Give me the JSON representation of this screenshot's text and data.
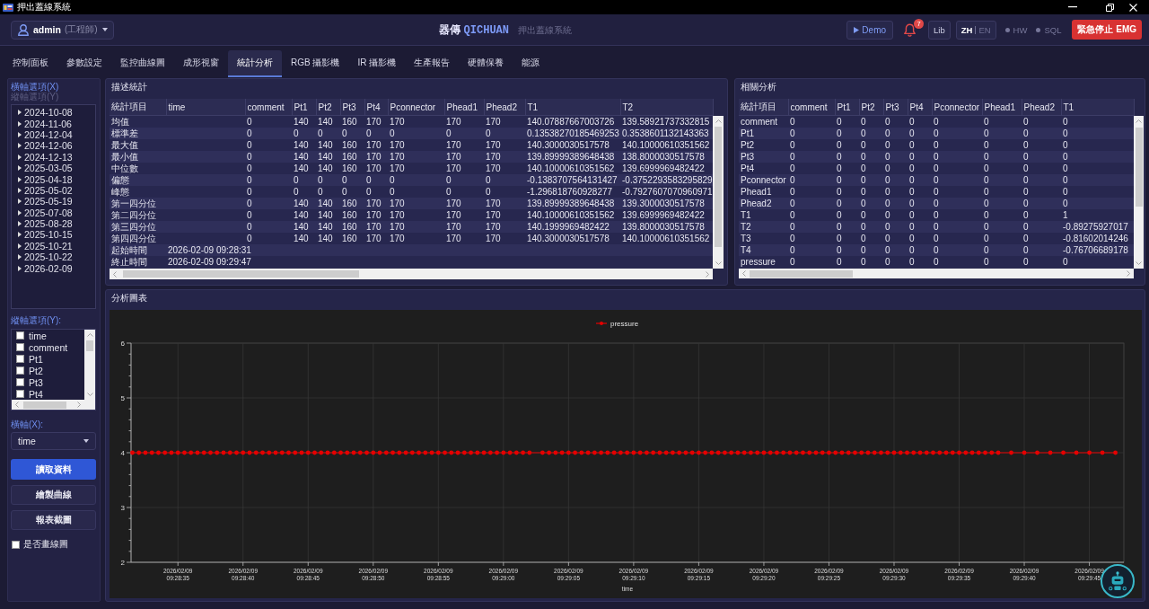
{
  "window": {
    "title": "押出蓋線系統"
  },
  "header": {
    "user": {
      "name": "admin",
      "role": "(工程師)"
    },
    "brand": {
      "chinese_name": "器傳",
      "english_name": "QICHUAN",
      "subtitle": "押出蓋線系統"
    },
    "demo_button": {
      "label": "Demo"
    },
    "notifications": {
      "count": "7"
    },
    "lib_button": {
      "label": "Lib"
    },
    "languages": [
      {
        "label": "ZH",
        "selected": true
      },
      {
        "label": "EN",
        "selected": false
      }
    ],
    "status": [
      {
        "label": "HW",
        "on": false
      },
      {
        "label": "SQL",
        "on": false
      }
    ],
    "emergency_button": {
      "label": "緊急停止 EMG"
    }
  },
  "tabs": [
    {
      "label": "控制面板",
      "selected": false
    },
    {
      "label": "參數設定",
      "selected": false
    },
    {
      "label": "監控曲線圖",
      "selected": false
    },
    {
      "label": "成形視窗",
      "selected": false
    },
    {
      "label": "統計分析",
      "selected": true
    },
    {
      "label": "RGB 攝影機",
      "selected": false
    },
    {
      "label": "IR 攝影機",
      "selected": false
    },
    {
      "label": "生產報告",
      "selected": false
    },
    {
      "label": "硬體保養",
      "selected": false
    },
    {
      "label": "能源",
      "selected": false
    }
  ],
  "sidebar": {
    "axis_tabs": [
      {
        "label": "橫軸選項(X)",
        "selected": true
      },
      {
        "label": "縱軸選項(Y)",
        "selected": false
      }
    ],
    "dates": [
      {
        "label": "2024-10-08",
        "expanded": false
      },
      {
        "label": "2024-11-06",
        "expanded": false
      },
      {
        "label": "2024-12-04",
        "expanded": false
      },
      {
        "label": "2024-12-06",
        "expanded": false
      },
      {
        "label": "2024-12-13",
        "expanded": false
      },
      {
        "label": "2025-03-05",
        "expanded": false
      },
      {
        "label": "2025-04-18",
        "expanded": false
      },
      {
        "label": "2025-05-02",
        "expanded": false
      },
      {
        "label": "2025-05-19",
        "expanded": false
      },
      {
        "label": "2025-07-08",
        "expanded": false
      },
      {
        "label": "2025-08-28",
        "expanded": false
      },
      {
        "label": "2025-10-15",
        "expanded": false
      },
      {
        "label": "2025-10-21",
        "expanded": false
      },
      {
        "label": "2025-10-22",
        "expanded": false
      },
      {
        "label": "2026-02-09",
        "expanded": false
      }
    ],
    "y_axis_label": "縱軸選項(Y):",
    "y_options": [
      {
        "label": "time",
        "checked": false
      },
      {
        "label": "comment",
        "checked": false
      },
      {
        "label": "Pt1",
        "checked": false
      },
      {
        "label": "Pt2",
        "checked": false
      },
      {
        "label": "Pt3",
        "checked": false
      },
      {
        "label": "Pt4",
        "checked": false
      }
    ],
    "x_axis_label": "橫軸(X):",
    "x_axis_select": {
      "value": "time"
    },
    "buttons": [
      {
        "label": "讀取資料",
        "kind": "primary"
      },
      {
        "label": "繪製曲線",
        "kind": "secondary"
      },
      {
        "label": "報表截圖",
        "kind": "secondary"
      }
    ],
    "draw_lines": {
      "label": "是否畫線圖",
      "checked": false
    }
  },
  "stats": {
    "title": "描述統計",
    "columns": [
      "統計項目",
      "time",
      "comment",
      "Pt1",
      "Pt2",
      "Pt3",
      "Pt4",
      "Pconnector",
      "Phead1",
      "Phead2",
      "T1",
      "T2"
    ],
    "rows": [
      {
        "kind": "stat",
        "label": "均值",
        "values": [
          "0",
          "140",
          "140",
          "160",
          "170",
          "170",
          "170",
          "170",
          "140.07887667003726",
          "139.58921737332815"
        ]
      },
      {
        "kind": "stat",
        "label": "標準差",
        "values": [
          "0",
          "0",
          "0",
          "0",
          "0",
          "0",
          "0",
          "0",
          "0.13538270185469253",
          "0.3538601132143363"
        ]
      },
      {
        "kind": "stat",
        "label": "最大值",
        "values": [
          "0",
          "140",
          "140",
          "160",
          "170",
          "170",
          "170",
          "170",
          "140.3000030517578",
          "140.10000610351562"
        ]
      },
      {
        "kind": "stat",
        "label": "最小值",
        "values": [
          "0",
          "140",
          "140",
          "160",
          "170",
          "170",
          "170",
          "170",
          "139.89999389648438",
          "138.8000030517578"
        ]
      },
      {
        "kind": "stat",
        "label": "中位數",
        "values": [
          "0",
          "140",
          "140",
          "160",
          "170",
          "170",
          "170",
          "170",
          "140.10000610351562",
          "139.6999969482422"
        ]
      },
      {
        "kind": "stat",
        "label": "偏態",
        "values": [
          "0",
          "0",
          "0",
          "0",
          "0",
          "0",
          "0",
          "0",
          "-0.1383707564131427",
          "-0.3752293583295829"
        ]
      },
      {
        "kind": "stat",
        "label": "峰態",
        "values": [
          "0",
          "0",
          "0",
          "0",
          "0",
          "0",
          "0",
          "0",
          "-1.296818760928277",
          "-0.7927607070960971"
        ]
      },
      {
        "kind": "stat",
        "label": "第一四分位",
        "values": [
          "0",
          "140",
          "140",
          "160",
          "170",
          "170",
          "170",
          "170",
          "139.89999389648438",
          "139.3000030517578"
        ]
      },
      {
        "kind": "stat",
        "label": "第二四分位",
        "values": [
          "0",
          "140",
          "140",
          "160",
          "170",
          "170",
          "170",
          "170",
          "140.10000610351562",
          "139.6999969482422"
        ]
      },
      {
        "kind": "stat",
        "label": "第三四分位",
        "values": [
          "0",
          "140",
          "140",
          "160",
          "170",
          "170",
          "170",
          "170",
          "140.1999969482422",
          "139.8000030517578"
        ]
      },
      {
        "kind": "stat",
        "label": "第四四分位",
        "values": [
          "0",
          "140",
          "140",
          "160",
          "170",
          "170",
          "170",
          "170",
          "140.3000030517578",
          "140.10000610351562"
        ]
      },
      {
        "kind": "range",
        "label": "起始時間",
        "value": "2026-02-09 09:28:31"
      },
      {
        "kind": "range",
        "label": "終止時間",
        "value": "2026-02-09 09:29:47"
      }
    ]
  },
  "correlation": {
    "title": "相關分析",
    "columns": [
      "統計項目",
      "comment",
      "Pt1",
      "Pt2",
      "Pt3",
      "Pt4",
      "Pconnector",
      "Phead1",
      "Phead2",
      "T1"
    ],
    "rows": [
      {
        "label": "comment",
        "values": [
          "0",
          "0",
          "0",
          "0",
          "0",
          "0",
          "0",
          "0",
          "0"
        ]
      },
      {
        "label": "Pt1",
        "values": [
          "0",
          "0",
          "0",
          "0",
          "0",
          "0",
          "0",
          "0",
          "0"
        ]
      },
      {
        "label": "Pt2",
        "values": [
          "0",
          "0",
          "0",
          "0",
          "0",
          "0",
          "0",
          "0",
          "0"
        ]
      },
      {
        "label": "Pt3",
        "values": [
          "0",
          "0",
          "0",
          "0",
          "0",
          "0",
          "0",
          "0",
          "0"
        ]
      },
      {
        "label": "Pt4",
        "values": [
          "0",
          "0",
          "0",
          "0",
          "0",
          "0",
          "0",
          "0",
          "0"
        ]
      },
      {
        "label": "Pconnector",
        "values": [
          "0",
          "0",
          "0",
          "0",
          "0",
          "0",
          "0",
          "0",
          "0"
        ]
      },
      {
        "label": "Phead1",
        "values": [
          "0",
          "0",
          "0",
          "0",
          "0",
          "0",
          "0",
          "0",
          "0"
        ]
      },
      {
        "label": "Phead2",
        "values": [
          "0",
          "0",
          "0",
          "0",
          "0",
          "0",
          "0",
          "0",
          "0"
        ]
      },
      {
        "label": "T1",
        "values": [
          "0",
          "0",
          "0",
          "0",
          "0",
          "0",
          "0",
          "0",
          "1"
        ]
      },
      {
        "label": "T2",
        "values": [
          "0",
          "0",
          "0",
          "0",
          "0",
          "0",
          "0",
          "0",
          "-0.89275927017"
        ]
      },
      {
        "label": "T3",
        "values": [
          "0",
          "0",
          "0",
          "0",
          "0",
          "0",
          "0",
          "0",
          "-0.81602014246"
        ]
      },
      {
        "label": "T4",
        "values": [
          "0",
          "0",
          "0",
          "0",
          "0",
          "0",
          "0",
          "0",
          "-0.76706689178"
        ]
      },
      {
        "label": "pressure",
        "values": [
          "0",
          "0",
          "0",
          "0",
          "0",
          "0",
          "0",
          "0",
          "0"
        ]
      }
    ]
  },
  "chart_panel": {
    "title": "分析圖表",
    "chart_data": {
      "type": "line",
      "xlabel": "time",
      "grid": true,
      "categories": [
        null,
        null,
        null,
        null,
        null,
        null,
        null,
        "2026/02/09 09:28:35",
        null,
        null,
        null,
        null,
        null,
        null,
        null,
        null,
        null,
        "2026/02/09 09:28:40",
        null,
        null,
        null,
        null,
        null,
        null,
        null,
        null,
        null,
        "2026/02/09 09:28:45",
        null,
        null,
        null,
        null,
        null,
        null,
        null,
        null,
        null,
        "2026/02/09 09:28:50",
        null,
        null,
        null,
        null,
        null,
        null,
        null,
        null,
        null,
        "2026/02/09 09:28:55",
        null,
        null,
        null,
        null,
        null,
        null,
        null,
        null,
        null,
        "2026/02/09 09:29:00",
        null,
        null,
        null,
        null,
        null,
        null,
        null,
        null,
        null,
        "2026/02/09 09:29:05",
        null,
        null,
        null,
        null,
        null,
        null,
        null,
        null,
        null,
        "2026/02/09 09:29:10",
        null,
        null,
        null,
        null,
        null,
        null,
        null,
        null,
        null,
        "2026/02/09 09:29:15",
        null,
        null,
        null,
        null,
        null,
        null,
        null,
        null,
        null,
        "2026/02/09 09:29:20",
        null,
        null,
        null,
        null,
        null,
        null,
        null,
        null,
        null,
        "2026/02/09 09:29:25",
        null,
        null,
        null,
        null,
        null,
        null,
        null,
        null,
        null,
        "2026/02/09 09:29:30",
        null,
        null,
        null,
        null,
        null,
        null,
        null,
        null,
        null,
        "2026/02/09 09:29:35",
        null,
        null,
        null,
        null,
        null,
        null,
        null,
        null,
        null,
        "2026/02/09 09:29:40",
        null,
        null,
        null,
        null,
        null,
        null,
        null,
        null,
        null,
        "2026/02/09 09:29:45",
        null,
        null,
        null,
        null,
        null
      ],
      "series": [
        {
          "name": "pressure",
          "color": "#e60000",
          "values": [
            4,
            4,
            4,
            4,
            4,
            4,
            4,
            4,
            4,
            4,
            4,
            4,
            4,
            4,
            4,
            4,
            4,
            4,
            4,
            4,
            4,
            4,
            4,
            4,
            4,
            4,
            4,
            4,
            4,
            4,
            4,
            4,
            4,
            4,
            4,
            4,
            4,
            4,
            4,
            4,
            4,
            4,
            4,
            4,
            4,
            4,
            4,
            4,
            4,
            4,
            4,
            4,
            4,
            4,
            4,
            4,
            4,
            4,
            4,
            4,
            4,
            4,
            null,
            4,
            4,
            4,
            4,
            4,
            4,
            4,
            4,
            4,
            4,
            4,
            4,
            4,
            4,
            4,
            4,
            4,
            4,
            4,
            4,
            4,
            4,
            4,
            4,
            4,
            4,
            4,
            4,
            4,
            4,
            4,
            4,
            4,
            4,
            4,
            4,
            4,
            4,
            4,
            4,
            4,
            4,
            4,
            4,
            4,
            4,
            4,
            4,
            4,
            4,
            4,
            4,
            4,
            4,
            4,
            4,
            4,
            4,
            4,
            4,
            4,
            4,
            4,
            4,
            4,
            4,
            4,
            4,
            4,
            4,
            4,
            null,
            4,
            null,
            4,
            null,
            4,
            null,
            4,
            null,
            4,
            null,
            4,
            null,
            4,
            null,
            4,
            null,
            4,
            null
          ]
        }
      ],
      "ylim": [
        2,
        6
      ],
      "yticks": [
        2,
        3,
        4,
        5,
        6
      ]
    }
  }
}
